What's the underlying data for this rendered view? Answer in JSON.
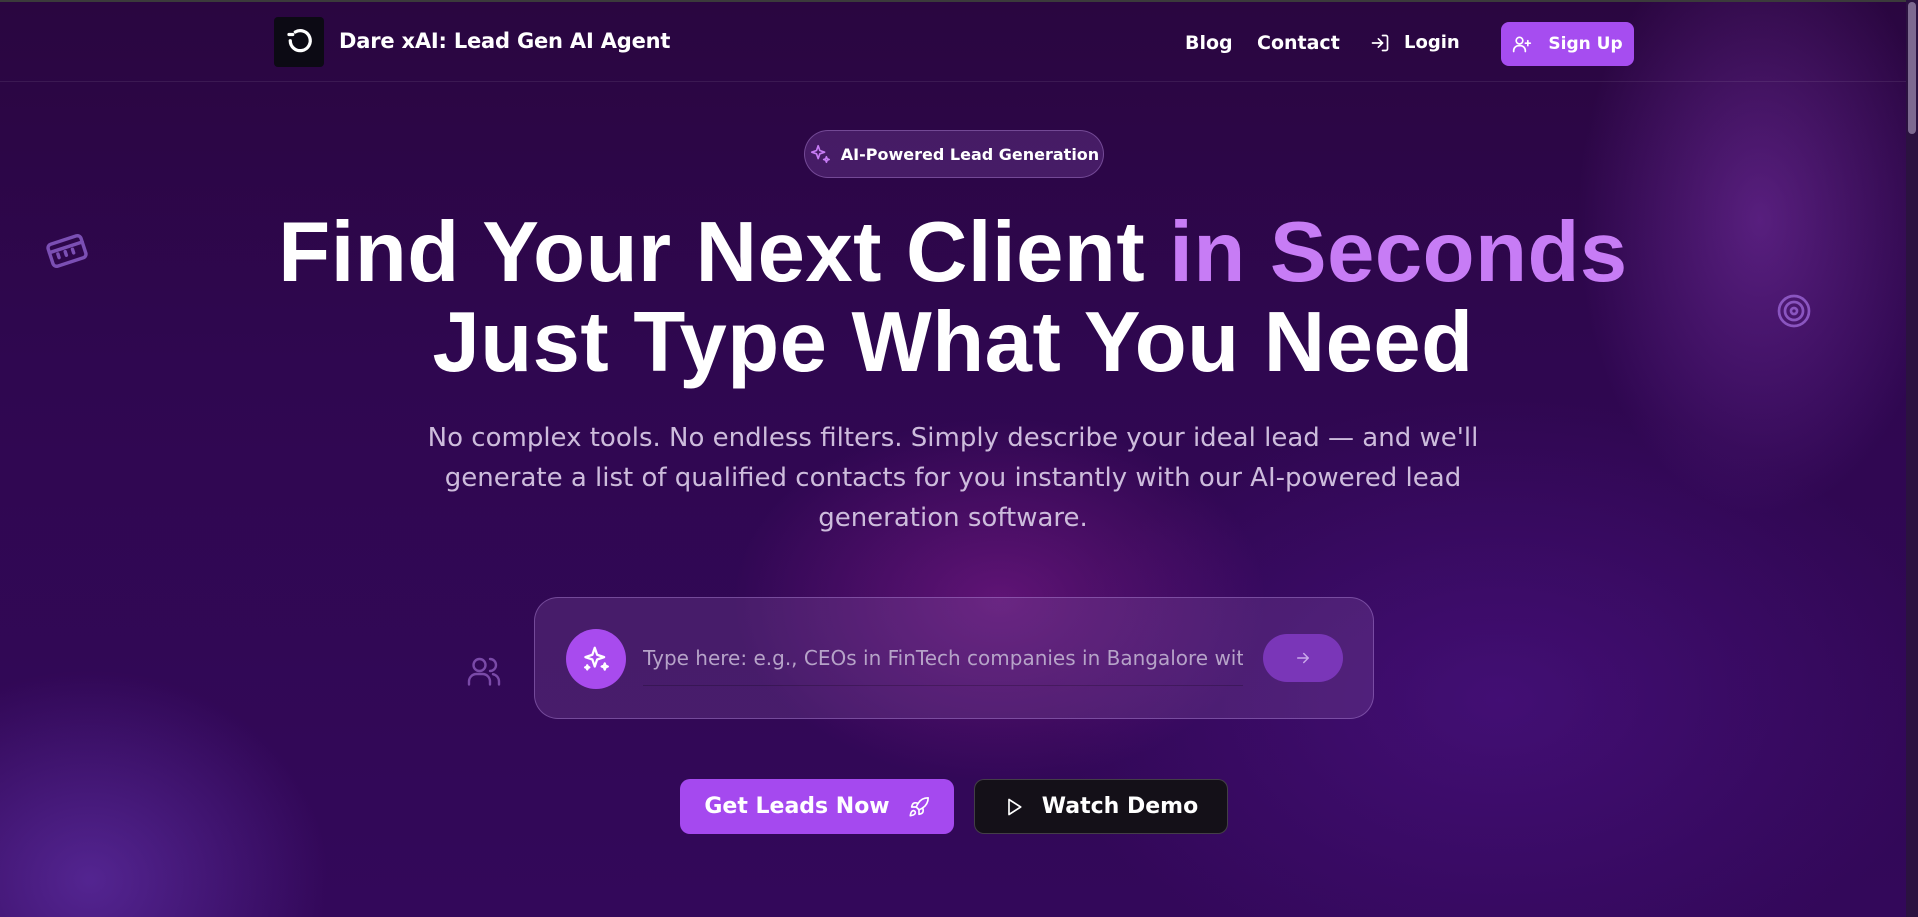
{
  "header": {
    "brand": "Dare xAI: Lead Gen AI Agent",
    "nav": {
      "blog": "Blog",
      "contact": "Contact",
      "login": "Login",
      "signup": "Sign Up"
    }
  },
  "badge": {
    "label": "AI-Powered Lead Generation"
  },
  "hero": {
    "headline_part1": "Find Your Next Client ",
    "headline_accent": "in Seconds",
    "headline_line2": "Just Type What You Need",
    "subtitle": "No complex tools. No endless filters. Simply describe your ideal lead — and we'll generate a list of qualified contacts for you instantly with our AI-powered lead generation software."
  },
  "search": {
    "placeholder": "Type here: e.g., CEOs in FinTech companies in Bangalore with",
    "value": ""
  },
  "cta": {
    "primary": "Get Leads Now",
    "secondary": "Watch Demo"
  },
  "colors": {
    "accent": "#a64df0",
    "headline_accent": "#c77cf5",
    "background": "#2a0640"
  },
  "icons": {
    "logo": "logo-icon",
    "login": "login-icon",
    "signup": "user-plus-icon",
    "badge": "sparkles-icon",
    "input": "sparkles-icon",
    "send": "arrow-right-icon",
    "primary_cta": "rocket-icon",
    "secondary_cta": "play-icon",
    "decorations": [
      "ticket-icon",
      "target-icon",
      "users-icon"
    ]
  }
}
